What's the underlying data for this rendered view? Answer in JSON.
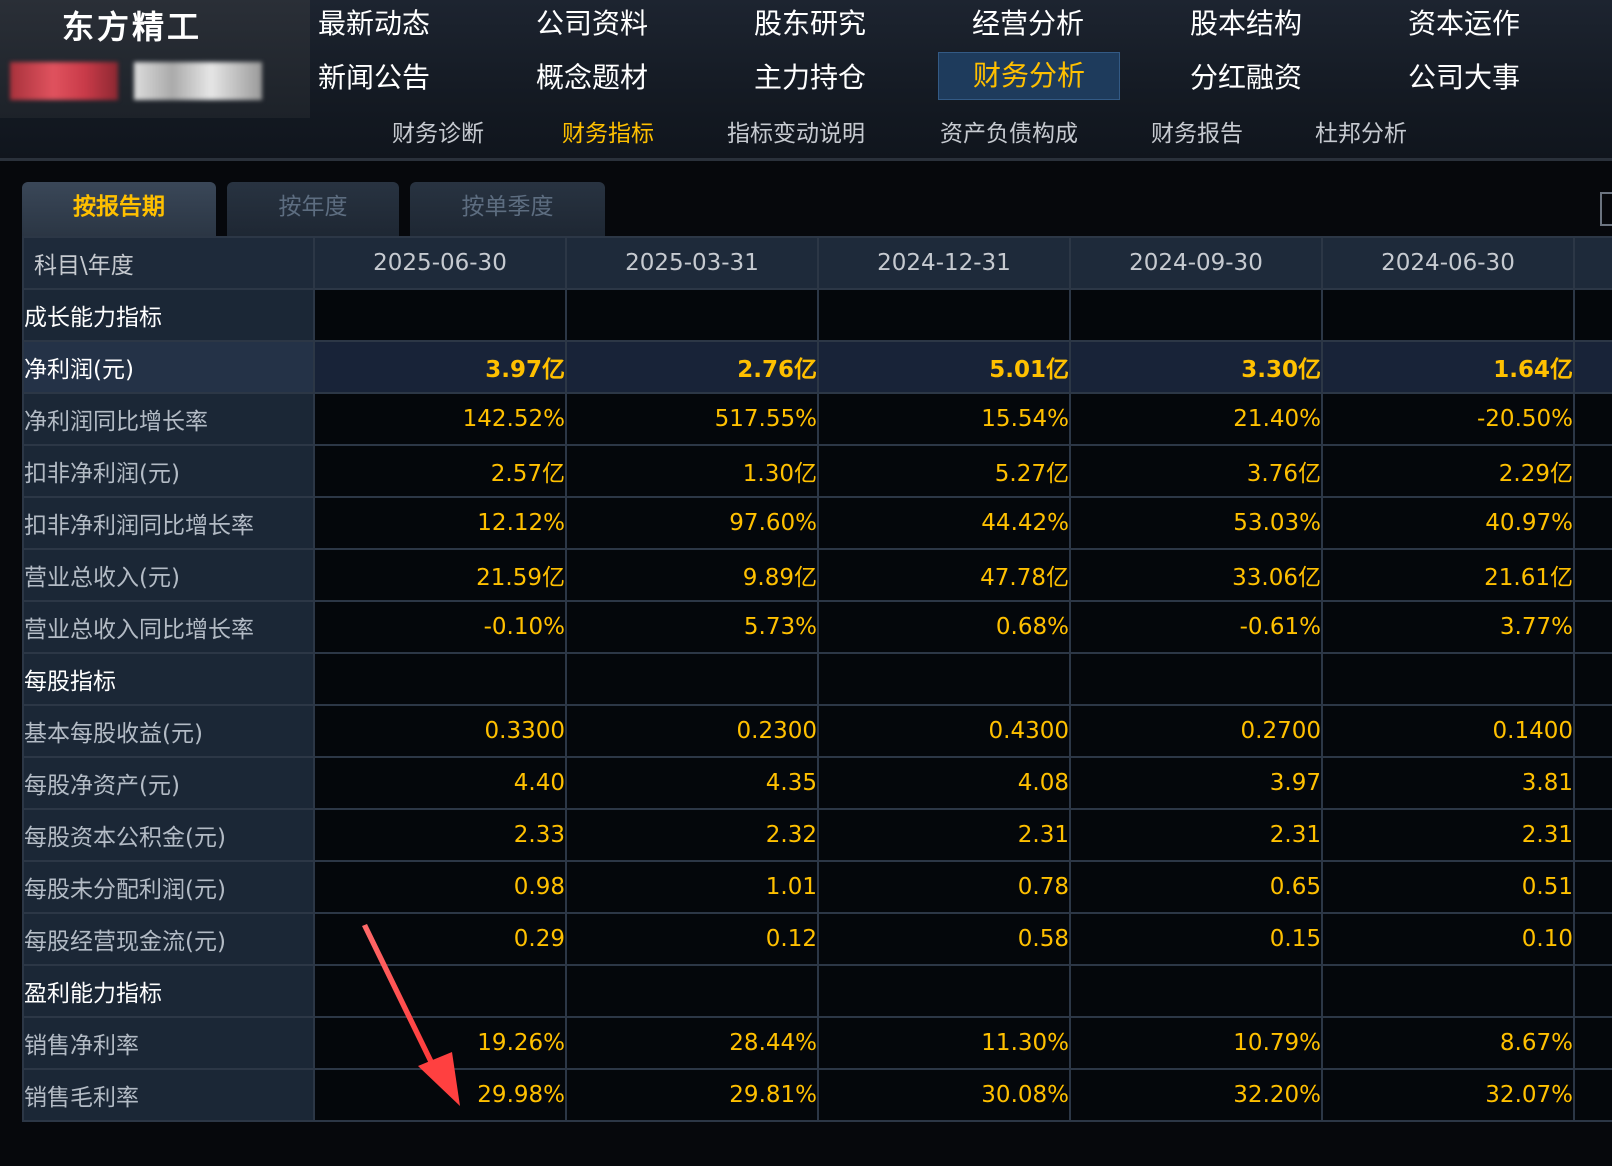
{
  "header": {
    "company_name": "东方精工",
    "nav_row1": [
      "最新动态",
      "公司资料",
      "股东研究",
      "经营分析",
      "股本结构",
      "资本运作"
    ],
    "nav_row2": [
      "新闻公告",
      "概念题材",
      "主力持仓",
      "财务分析",
      "分红融资",
      "公司大事"
    ],
    "active_nav": "财务分析"
  },
  "subnav": {
    "items": [
      "财务诊断",
      "财务指标",
      "指标变动说明",
      "资产负债构成",
      "财务报告",
      "杜邦分析"
    ],
    "active": "财务指标"
  },
  "tabs": {
    "items": [
      "按报告期",
      "按年度",
      "按单季度"
    ],
    "active": "按报告期"
  },
  "table": {
    "header_label": "科目\\年度",
    "periods": [
      "2025-06-30",
      "2025-03-31",
      "2024-12-31",
      "2024-09-30",
      "2024-06-30"
    ],
    "rows": [
      {
        "label": "成长能力指标",
        "section": true,
        "values": [
          "",
          "",
          "",
          "",
          ""
        ]
      },
      {
        "label": "净利润(元)",
        "highlight": true,
        "values": [
          "3.97亿",
          "2.76亿",
          "5.01亿",
          "3.30亿",
          "1.64亿"
        ]
      },
      {
        "label": "净利润同比增长率",
        "values": [
          "142.52%",
          "517.55%",
          "15.54%",
          "21.40%",
          "-20.50%"
        ]
      },
      {
        "label": "扣非净利润(元)",
        "values": [
          "2.57亿",
          "1.30亿",
          "5.27亿",
          "3.76亿",
          "2.29亿"
        ]
      },
      {
        "label": "扣非净利润同比增长率",
        "values": [
          "12.12%",
          "97.60%",
          "44.42%",
          "53.03%",
          "40.97%"
        ]
      },
      {
        "label": "营业总收入(元)",
        "values": [
          "21.59亿",
          "9.89亿",
          "47.78亿",
          "33.06亿",
          "21.61亿"
        ]
      },
      {
        "label": "营业总收入同比增长率",
        "values": [
          "-0.10%",
          "5.73%",
          "0.68%",
          "-0.61%",
          "3.77%"
        ]
      },
      {
        "label": "每股指标",
        "section": true,
        "values": [
          "",
          "",
          "",
          "",
          ""
        ]
      },
      {
        "label": "基本每股收益(元)",
        "values": [
          "0.3300",
          "0.2300",
          "0.4300",
          "0.2700",
          "0.1400"
        ]
      },
      {
        "label": "每股净资产(元)",
        "values": [
          "4.40",
          "4.35",
          "4.08",
          "3.97",
          "3.81"
        ]
      },
      {
        "label": "每股资本公积金(元)",
        "values": [
          "2.33",
          "2.32",
          "2.31",
          "2.31",
          "2.31"
        ]
      },
      {
        "label": "每股未分配利润(元)",
        "values": [
          "0.98",
          "1.01",
          "0.78",
          "0.65",
          "0.51"
        ]
      },
      {
        "label": "每股经营现金流(元)",
        "values": [
          "0.29",
          "0.12",
          "0.58",
          "0.15",
          "0.10"
        ]
      },
      {
        "label": "盈利能力指标",
        "section": true,
        "values": [
          "",
          "",
          "",
          "",
          ""
        ]
      },
      {
        "label": "销售净利率",
        "values": [
          "19.26%",
          "28.44%",
          "11.30%",
          "10.79%",
          "8.67%"
        ]
      },
      {
        "label": "销售毛利率",
        "values": [
          "29.98%",
          "29.81%",
          "30.08%",
          "32.20%",
          "32.07%"
        ]
      }
    ]
  },
  "colors": {
    "accent": "#ffc000",
    "arrow": "#ff4a4a",
    "header_bg": "#1e2a3a",
    "cell_bg": "#04070b"
  }
}
